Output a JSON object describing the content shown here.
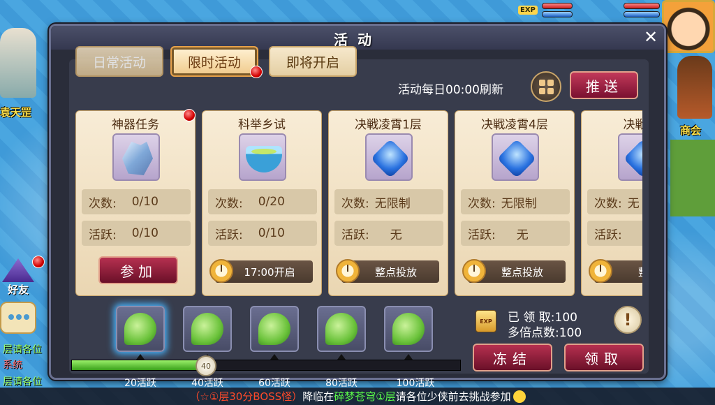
{
  "world": {
    "npc_left_name": "袁天罡",
    "npc_right_name": "商会",
    "friends_label": "好友",
    "exp_label": "EXP",
    "chat_lines": [
      "层请各位",
      "系统",
      "层请各位"
    ]
  },
  "marquee": {
    "prefix": "（☆①层30分BOSS怪）",
    "middle": "降临在",
    "location": "碎梦苍穹①层",
    "suffix": "请各位少侠前去挑战参加"
  },
  "dialog": {
    "title": "活动",
    "close_symbol": "✕"
  },
  "tabs": [
    {
      "label": "日常活动",
      "state": "inactive"
    },
    {
      "label": "限时活动",
      "state": "active"
    },
    {
      "label": "即将开启",
      "state": "normal"
    }
  ],
  "refresh_text": "活动每日00:00刷新",
  "push_label": "推送",
  "activities": [
    {
      "title": "神器任务",
      "icon": "crystal-icon",
      "count_label": "次数:",
      "count": "0/10",
      "active_label": "活跃:",
      "active": "0/10",
      "action": "参加",
      "action_type": "button"
    },
    {
      "title": "科举乡试",
      "icon": "bowl-icon",
      "count_label": "次数:",
      "count": "0/20",
      "active_label": "活跃:",
      "active": "0/10",
      "action": "17:00开启",
      "action_type": "time"
    },
    {
      "title": "决戦凌霄1层",
      "icon": "gem-icon",
      "count_label": "次数:",
      "count": "无限制",
      "active_label": "活跃:",
      "active": "无",
      "action": "整点投放",
      "action_type": "time"
    },
    {
      "title": "决戦凌霄4层",
      "icon": "gem-icon",
      "count_label": "次数:",
      "count": "无限制",
      "active_label": "活跃:",
      "active": "无",
      "action": "整点投放",
      "action_type": "time"
    },
    {
      "title": "决戦凌",
      "icon": "gem-icon",
      "count_label": "次数:",
      "count": "无",
      "active_label": "活跃:",
      "active": "",
      "action": "整点",
      "action_type": "time"
    }
  ],
  "progress": {
    "value": 40,
    "max": 100,
    "knob_label": "40",
    "milestones": [
      "20活跃",
      "40活跃",
      "60活跃",
      "80活跃",
      "100活跃"
    ]
  },
  "rewards": {
    "exp_icon_label": "EXP",
    "received_label": "已 领 取:100",
    "multiplier_label": "多倍点数:100",
    "alert_symbol": "!",
    "freeze_label": "冻结",
    "claim_label": "领取"
  }
}
